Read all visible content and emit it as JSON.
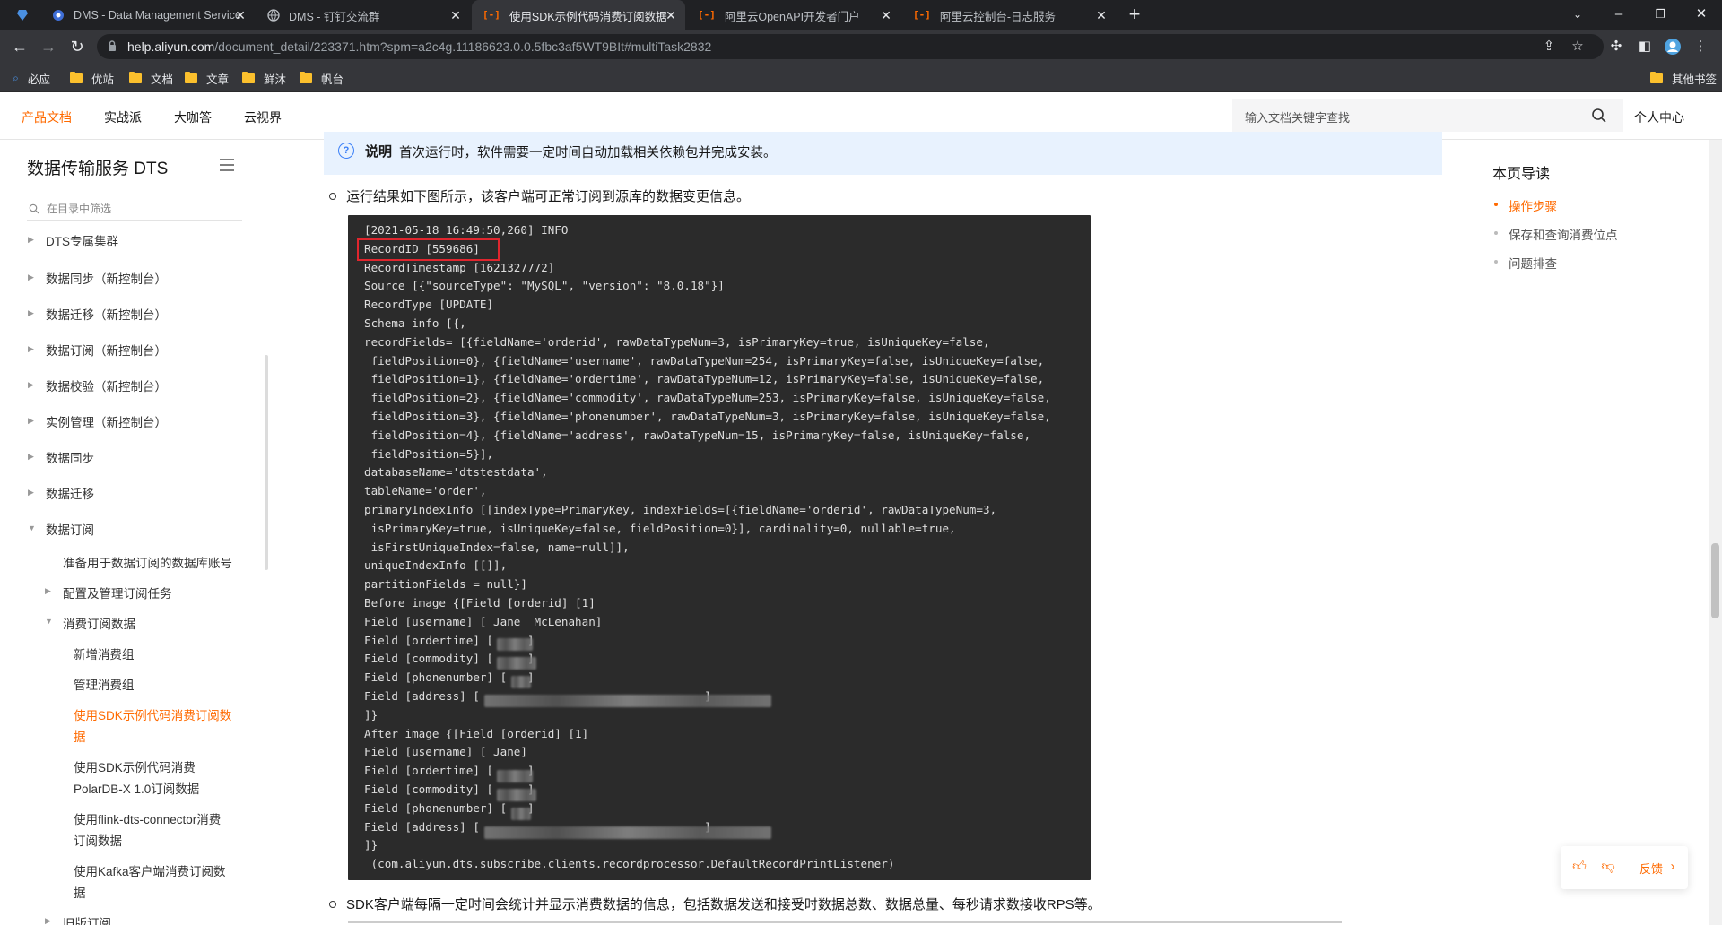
{
  "tabs": [
    {
      "label": "DMS - Data Management Service",
      "active": false
    },
    {
      "label": "DMS - 钉钉交流群",
      "active": false
    },
    {
      "label": "使用SDK示例代码消费订阅数据",
      "active": true
    },
    {
      "label": "阿里云OpenAPI开发者门户",
      "active": false
    },
    {
      "label": "阿里云控制台-日志服务",
      "active": false
    }
  ],
  "url": {
    "host": "help.aliyun.com",
    "path": "/document_detail/223371.htm?spm=a2c4g.11186623.0.0.5fbc3af5WT9BIt#multiTask2832"
  },
  "bookmarks": [
    "必应",
    "优站",
    "文档",
    "文章",
    "鲜沐",
    "帆台"
  ],
  "other_bookmarks": "其他书签",
  "site_nav": [
    "产品文档",
    "实战派",
    "大咖答",
    "云视界"
  ],
  "search_placeholder": "输入文档关键字查找",
  "personal_center": "个人中心",
  "sidebar": {
    "title": "数据传输服务 DTS",
    "filter_placeholder": "在目录中筛选",
    "items": [
      "DTS专属集群",
      "数据同步（新控制台）",
      "数据迁移（新控制台）",
      "数据订阅（新控制台）",
      "数据校验（新控制台）",
      "实例管理（新控制台）",
      "数据同步",
      "数据迁移",
      "数据订阅",
      "准备用于数据订阅的数据库账号",
      "配置及管理订阅任务",
      "消费订阅数据",
      "新增消费组",
      "管理消费组",
      "使用SDK示例代码消费订阅数",
      "据",
      "使用SDK示例代码消费",
      "PolarDB-X 1.0订阅数据",
      "使用flink-dts-connector消费",
      "订阅数据",
      "使用Kafka客户端消费订阅数",
      "据",
      "旧版订阅"
    ]
  },
  "note": {
    "label": "说明",
    "text": "首次运行时，软件需要一定时间自动加载相关依赖包并完成安装。"
  },
  "para1": "运行结果如下图所示，该客户端可正常订阅到源库的数据变更信息。",
  "code_lines": [
    "[2021-05-18 16:49:50,260] INFO",
    "RecordID [559686]",
    "RecordTimestamp [1621327772]",
    "Source [{\"sourceType\": \"MySQL\", \"version\": \"8.0.18\"}]",
    "RecordType [UPDATE]",
    "Schema info [{,",
    "recordFields= [{fieldName='orderid', rawDataTypeNum=3, isPrimaryKey=true, isUniqueKey=false,",
    " fieldPosition=0}, {fieldName='username', rawDataTypeNum=254, isPrimaryKey=false, isUniqueKey=false,",
    " fieldPosition=1}, {fieldName='ordertime', rawDataTypeNum=12, isPrimaryKey=false, isUniqueKey=false,",
    " fieldPosition=2}, {fieldName='commodity', rawDataTypeNum=253, isPrimaryKey=false, isUniqueKey=false,",
    " fieldPosition=3}, {fieldName='phonenumber', rawDataTypeNum=3, isPrimaryKey=false, isUniqueKey=false,",
    " fieldPosition=4}, {fieldName='address', rawDataTypeNum=15, isPrimaryKey=false, isUniqueKey=false,",
    " fieldPosition=5}],",
    "databaseName='dtstestdata',",
    "tableName='order',",
    "primaryIndexInfo [[indexType=PrimaryKey, indexFields=[{fieldName='orderid', rawDataTypeNum=3,",
    " isPrimaryKey=true, isUniqueKey=false, fieldPosition=0}], cardinality=0, nullable=true,",
    " isFirstUniqueIndex=false, name=null]],",
    "uniqueIndexInfo [[]],",
    "partitionFields = null}]",
    "Before image {[Field [orderid] [1]",
    "Field [username] [ Jane  McLenahan]",
    "Field [ordertime] [     ]",
    "Field [commodity] [     ]",
    "Field [phonenumber] [   ]",
    "Field [address] [                                 ]",
    "]}",
    "After image {[Field [orderid] [1]",
    "Field [username] [ Jane]",
    "Field [ordertime] [     ]",
    "Field [commodity] [     ]",
    "Field [phonenumber] [   ]",
    "Field [address] [                                 ]",
    "]}",
    " (com.aliyun.dts.subscribe.clients.recordprocessor.DefaultRecordPrintListener)"
  ],
  "para2": "SDK客户端每隔一定时间会统计并显示消费数据的信息，包括数据发送和接受时数据总数、数据总量、每秒请求数接收RPS等。",
  "toc": {
    "title": "本页导读",
    "items": [
      "操作步骤",
      "保存和查询消费位点",
      "问题排查"
    ]
  },
  "feedback_label": "反馈",
  "colors": {
    "accent": "#ff6a00",
    "highlight_box": "#e0262e",
    "note_bg": "#e8f2fe"
  }
}
